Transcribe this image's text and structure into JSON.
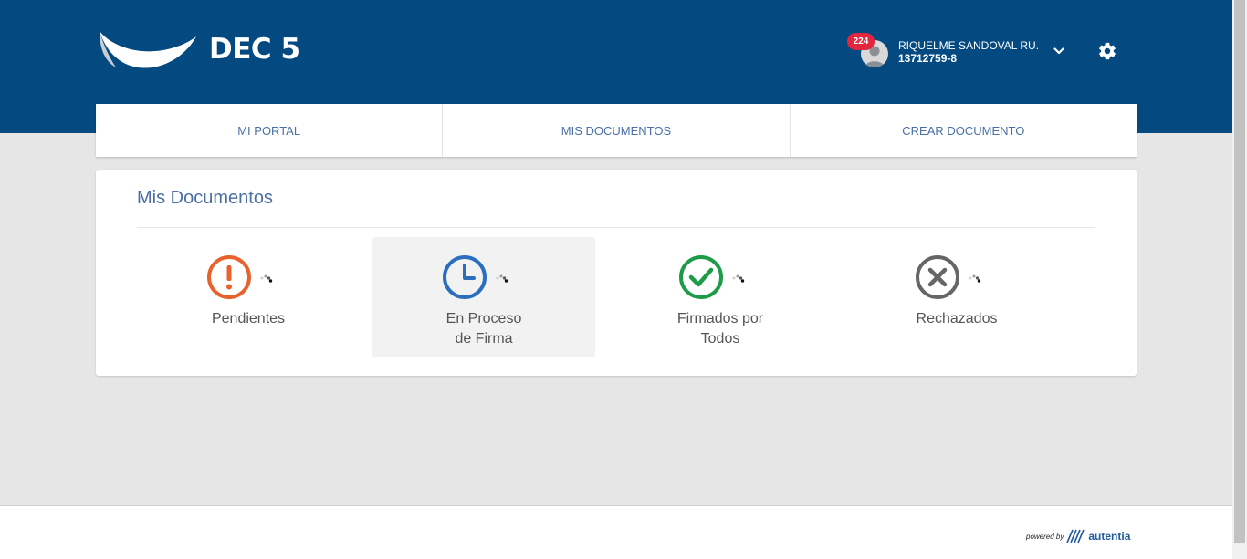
{
  "header": {
    "logo_text": "DEC 5",
    "notification_count": "224",
    "user_name": "RIQUELME SANDOVAL RU...",
    "user_id": "13712759-8"
  },
  "nav": {
    "items": [
      {
        "label": "MI PORTAL"
      },
      {
        "label": "MIS DOCUMENTOS"
      },
      {
        "label": "CREAR DOCUMENTO"
      }
    ]
  },
  "documents": {
    "title": "Mis Documentos",
    "tiles": [
      {
        "label": "Pendientes",
        "icon": "exclamation-circle-icon",
        "color": "#e8622c"
      },
      {
        "label": "En Proceso\nde Firma",
        "icon": "clock-icon",
        "color": "#2a6ebd",
        "active": true
      },
      {
        "label": "Firmados por\nTodos",
        "icon": "check-circle-icon",
        "color": "#1e9b48"
      },
      {
        "label": "Rechazados",
        "icon": "x-circle-icon",
        "color": "#666666"
      }
    ]
  },
  "footer": {
    "powered_by": "powered by",
    "brand": "autentia"
  }
}
